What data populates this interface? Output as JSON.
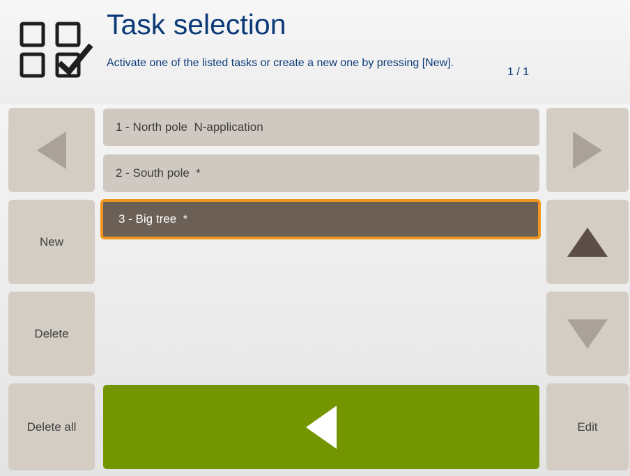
{
  "header": {
    "title": "Task selection",
    "subtitle": "Activate one of the listed tasks or create a new one by pressing [New].",
    "page_indicator": "1 / 1",
    "icon": "task-checklist-icon"
  },
  "left_buttons": {
    "prev_icon": "arrow-left-icon",
    "new_label": "New",
    "delete_label": "Delete",
    "delete_all_label": "Delete all"
  },
  "right_buttons": {
    "next_icon": "arrow-right-icon",
    "up_icon": "arrow-up-icon",
    "down_icon": "arrow-down-icon",
    "edit_label": "Edit"
  },
  "tasks": [
    {
      "label": "1 - North pole  N-application",
      "selected": false
    },
    {
      "label": "2 - South pole  *",
      "selected": false
    },
    {
      "label": "3 - Big tree  *",
      "selected": true
    }
  ],
  "confirm_button": {
    "icon": "play-back-icon"
  },
  "colors": {
    "title": "#0b3a78",
    "button_bg": "#d3cdc4",
    "selected_row": "#6b5f56",
    "selection_border": "#f0961e",
    "confirm_green": "#739600",
    "arrow_enabled": "#5c4e46",
    "arrow_disabled": "#a9a19a"
  }
}
